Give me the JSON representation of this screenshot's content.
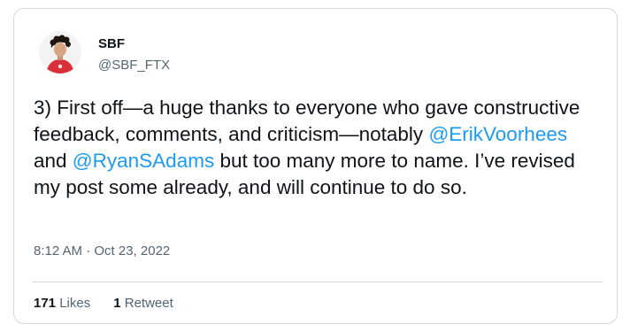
{
  "author": {
    "name": "SBF",
    "handle": "@SBF_FTX"
  },
  "tweet": {
    "text_1": "3) First off—a huge thanks to everyone who gave constructive feedback, comments, and criticism—notably ",
    "mention_1": "@ErikVoorhees",
    "text_2": " and ",
    "mention_2": "@RyanSAdams",
    "text_3": " but too many more to name.  I’ve revised my post some already, and will continue to do so.",
    "timestamp": "8:12 AM · Oct 23, 2022"
  },
  "stats": {
    "likes_count": "171",
    "likes_label": "Likes",
    "retweets_count": "1",
    "retweets_label": "Retweet"
  },
  "colors": {
    "link": "#1d9bf0",
    "text": "#0f1419",
    "secondary": "#536471",
    "border": "#cfd9de"
  }
}
